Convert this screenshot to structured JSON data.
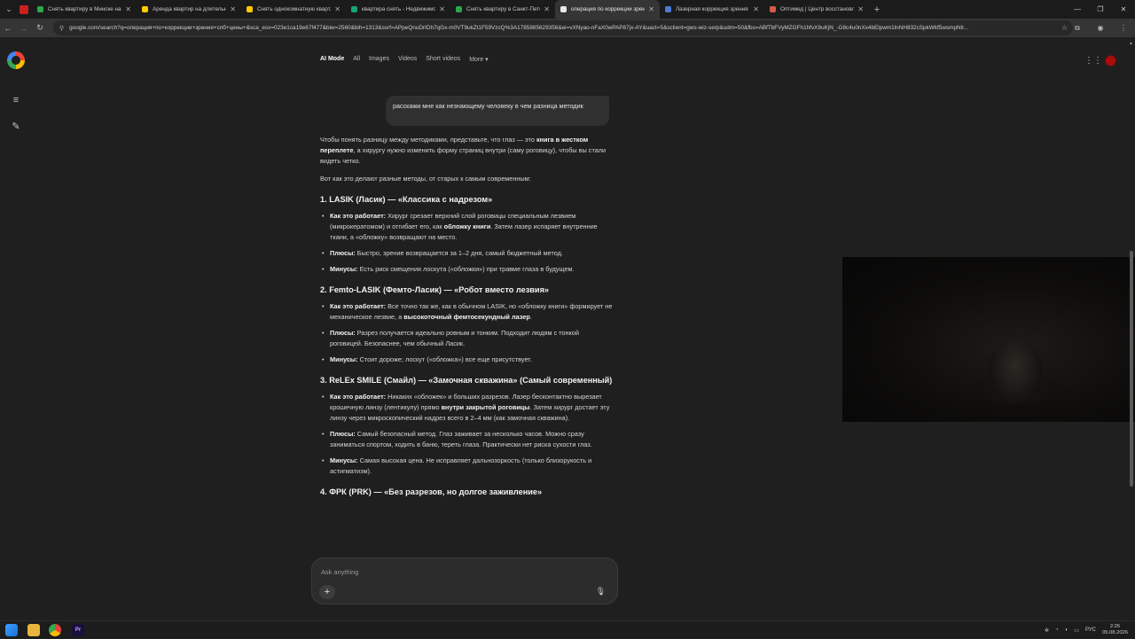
{
  "browser": {
    "tabs": [
      {
        "title": "Снять квартиру в Минске на д...",
        "icon": "zillow-icon",
        "color": "#2aa84a",
        "active": false
      },
      {
        "title": "Аренда квартир на длительн...",
        "icon": "yandex-realty-icon",
        "color": "#ffcc00",
        "active": false
      },
      {
        "title": "Снять однокомнатную кварт...",
        "icon": "yandex-realty-icon",
        "color": "#ffcc00",
        "active": false
      },
      {
        "title": "квартира снять - Недвижимо...",
        "icon": "listing-icon",
        "color": "#1aa37a",
        "active": false
      },
      {
        "title": "Снять квартиру в Санкт-Петер...",
        "icon": "listing-icon",
        "color": "#2aa84a",
        "active": false
      },
      {
        "title": "операция по коррекции зрен...",
        "icon": "google-icon",
        "color": "#e8e8e8",
        "active": true
      },
      {
        "title": "Лазерная коррекция зрения",
        "icon": "clinic-icon",
        "color": "#4a7bd6",
        "active": false
      },
      {
        "title": "Оптимед | Центр восстановле...",
        "icon": "clinic-icon",
        "color": "#d65a4a",
        "active": false
      }
    ],
    "url": "google.com/search?q=операция+по+коррекции+зрения+спб+цены+&sca_esv=023e1ca19e67f477&biw=2560&bih=1313&ssrf=APpeQnuDrIDh7qGx-m0VT9ukZt1F59VzcQ%3A1785885629356&ei=vXNyao-nFaX0wPAP87jx-AY&uact=5&sclient=gws-wiz-serp&udm=50&fbs=ABfTbFVyMZGFh1hfvX9uKjN_-G8c4u0nXx4bElpwm1lnNH832cSpkWkf5wsmpNlr..."
  },
  "search": {
    "nav": [
      "AI Mode",
      "All",
      "Images",
      "Videos",
      "Short videos",
      "More ▾"
    ],
    "selected": "AI Mode"
  },
  "conversation": {
    "user_message": "расскажи мне как незнающему человеку в чем разница методик",
    "intro_1_a": "Чтобы понять разницу между методиками, представьте, что глаз — это ",
    "intro_1_b": "книга в жестком переплете",
    "intro_1_c": ", а хирургу нужно изменить форму страниц внутри (саму роговицу), чтобы вы стали видеть четко.",
    "intro_2": "Вот как это делают разные методы, от старых к самым современным:",
    "sections": [
      {
        "title": "1. LASIK (Ласик) — «Классика с надрезом»",
        "items": [
          {
            "label": "Как это работает:",
            "a": " Хирург срезает верхний слой роговицы специальным лезвием (микрокератомом) и отгибает его, как ",
            "b": "обложку книги",
            "c": ". Затем лазер испаряет внутренние ткани, а «обложку» возвращают на место."
          },
          {
            "label": "Плюсы:",
            "a": " Быстро, зрение возвращается за 1–2 дня, самый бюджетный метод.",
            "b": "",
            "c": ""
          },
          {
            "label": "Минусы:",
            "a": " Есть риск смещения лоскута («обложки») при травме глаза в будущем.",
            "b": "",
            "c": ""
          }
        ]
      },
      {
        "title": "2. Femto-LASIK (Фемто-Ласик) — «Робот вместо лезвия»",
        "items": [
          {
            "label": "Как это работает:",
            "a": " Все точно так же, как в обычном LASIK, но «обложку книги» формирует не механическое лезвие, а ",
            "b": "высокоточный фемтосекундный лазер",
            "c": "."
          },
          {
            "label": "Плюсы:",
            "a": " Разрез получается идеально ровным и тонким. Подходит людям с тонкой роговицей. Безопаснее, чем обычный Ласик.",
            "b": "",
            "c": ""
          },
          {
            "label": "Минусы:",
            "a": " Стоит дороже; лоскут («обложка») все еще присутствует.",
            "b": "",
            "c": ""
          }
        ]
      },
      {
        "title": "3. ReLEx SMILE (Смайл) — «Замочная скважина» (Самый современный)",
        "items": [
          {
            "label": "Как это работает:",
            "a": " Никаких «обложек» и больших разрезов. Лазер бесконтактно вырезает крошечную линзу (лентикулу) прямо ",
            "b": "внутри закрытой роговицы",
            "c": ". Затем хирург достает эту линзу через микроскопический надрез всего в 2–4 мм (как замочная скважина)."
          },
          {
            "label": "Плюсы:",
            "a": " Самый безопасный метод. Глаз заживает за несколько часов. Можно сразу заниматься спортом, ходить в баню, тереть глаза. Практически нет риска сухости глаз.",
            "b": "",
            "c": ""
          },
          {
            "label": "Минусы:",
            "a": " Самая высокая цена. Не исправляет дальнозоркость (только близорукость и астигматизм).",
            "b": "",
            "c": ""
          }
        ]
      },
      {
        "title": "4. ФРК (PRK) — «Без разрезов, но долгое заживление»",
        "items": []
      }
    ]
  },
  "composer": {
    "placeholder": "Ask anything"
  },
  "taskbar": {
    "language": "РУС",
    "time": "2:26",
    "date": "05.08.2026"
  }
}
